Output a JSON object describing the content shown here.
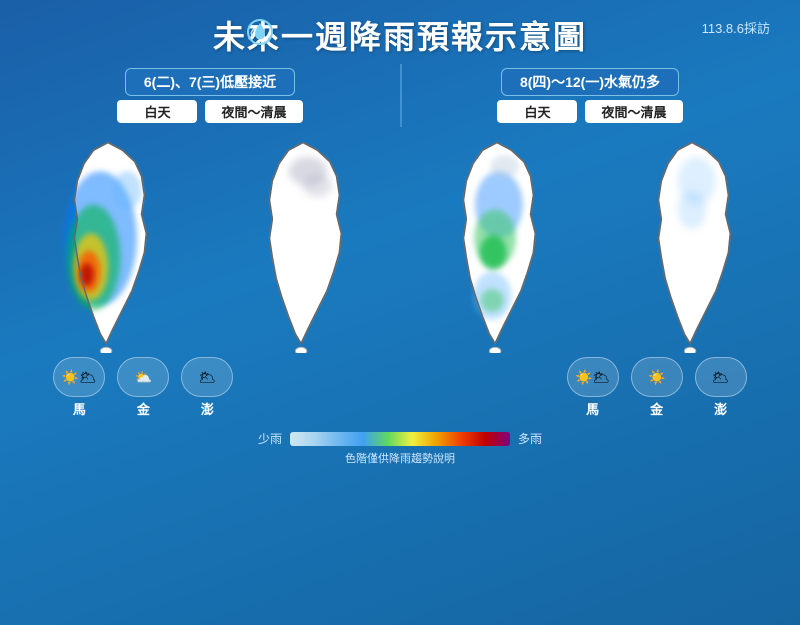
{
  "header": {
    "title": "未來一週降雨預報示意圖",
    "date": "113.8.6採訪"
  },
  "left_section": {
    "title": "6(二)、7(三)低壓接近",
    "day_label": "白天",
    "night_label": "夜間～清晨"
  },
  "right_section": {
    "title": "8(四)～12(一)水氣仍多",
    "day_label": "白天",
    "night_label": "夜間～清晨"
  },
  "islands_left": [
    {
      "name": "馬",
      "weather": "☀️🌥"
    },
    {
      "name": "金",
      "weather": "⛅"
    },
    {
      "name": "澎",
      "weather": "🌥"
    }
  ],
  "islands_right": [
    {
      "name": "馬",
      "weather": "☀️🌥"
    },
    {
      "name": "金",
      "weather": "☀️"
    },
    {
      "name": "澎",
      "weather": "🌥"
    }
  ],
  "legend": {
    "low_label": "少雨",
    "high_label": "多雨",
    "note": "色階僅供降雨趨勢說明"
  }
}
